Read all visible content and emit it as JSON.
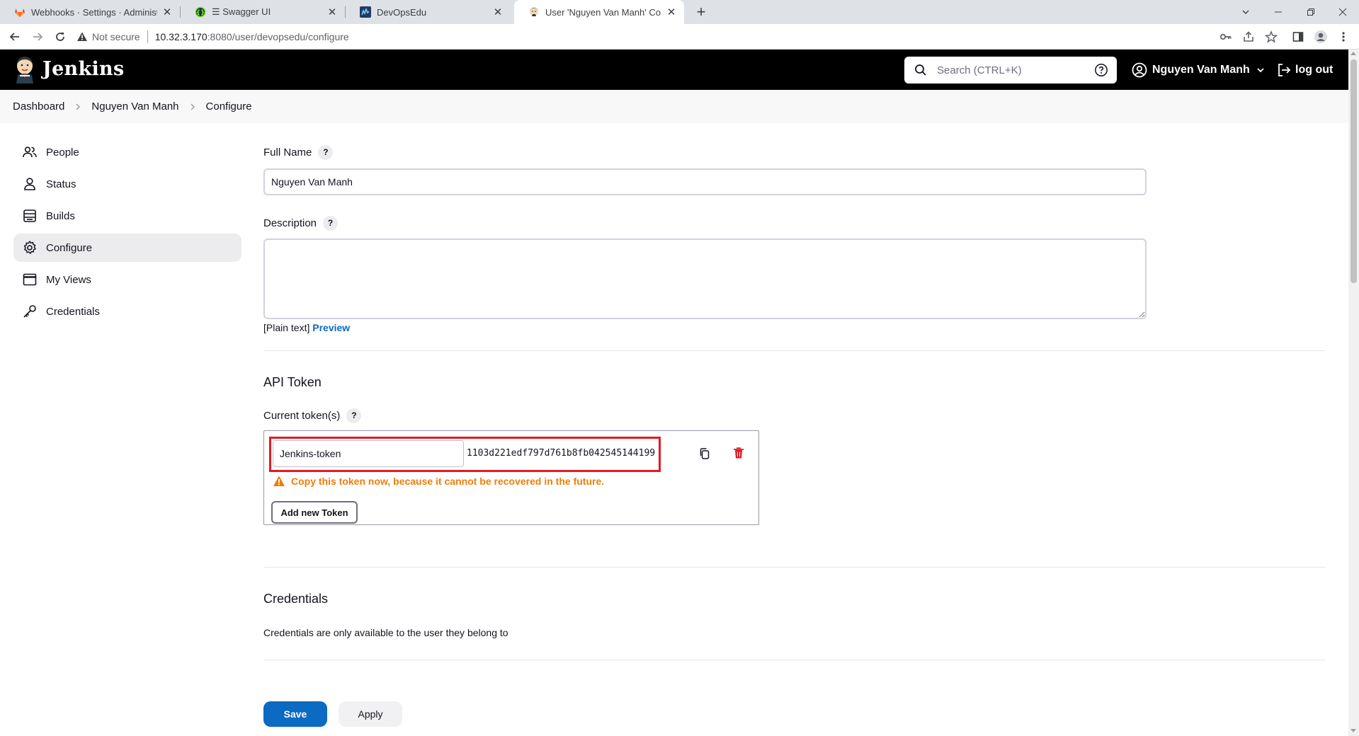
{
  "browser": {
    "tabs": [
      {
        "title": "Webhooks · Settings · Administra",
        "icon": "gitlab-icon"
      },
      {
        "title": "☰ Swagger UI",
        "icon": "swagger-icon"
      },
      {
        "title": "DevOpsEdu",
        "icon": "devopsedu-icon"
      },
      {
        "title": "User 'Nguyen Van Manh' Configu",
        "icon": "jenkins-icon",
        "active": true
      }
    ],
    "not_secure": "Not secure",
    "url_host": "10.32.3.170",
    "url_path": ":8080/user/devopsedu/configure"
  },
  "header": {
    "brand": "Jenkins",
    "search_placeholder": "Search (CTRL+K)",
    "user_name": "Nguyen Van Manh",
    "logout": "log out"
  },
  "breadcrumb": [
    "Dashboard",
    "Nguyen Van Manh",
    "Configure"
  ],
  "sidebar": {
    "items": [
      {
        "label": "People",
        "icon": "people-icon"
      },
      {
        "label": "Status",
        "icon": "user-icon"
      },
      {
        "label": "Builds",
        "icon": "builds-icon"
      },
      {
        "label": "Configure",
        "icon": "gear-icon",
        "active": true
      },
      {
        "label": "My Views",
        "icon": "window-icon"
      },
      {
        "label": "Credentials",
        "icon": "key-icon"
      }
    ]
  },
  "form": {
    "full_name_label": "Full Name",
    "full_name_value": "Nguyen Van Manh",
    "description_label": "Description",
    "description_value": "",
    "plain_text": "[Plain text]",
    "preview": "Preview",
    "help": "?",
    "api_token_title": "API Token",
    "current_tokens_label": "Current token(s)",
    "token": {
      "name": "Jenkins-token",
      "value": "1103d221edf797d761b8fb042545144199",
      "warning": "Copy this token now, because it cannot be recovered in the future."
    },
    "add_token": "Add new Token",
    "credentials_title": "Credentials",
    "credentials_text": "Credentials are only available to the user they belong to"
  },
  "actions": {
    "save": "Save",
    "apply": "Apply"
  },
  "colors": {
    "accent": "#0b6ac2",
    "warning": "#ef7d09",
    "danger": "#e01b24",
    "header_bg": "#000000"
  }
}
